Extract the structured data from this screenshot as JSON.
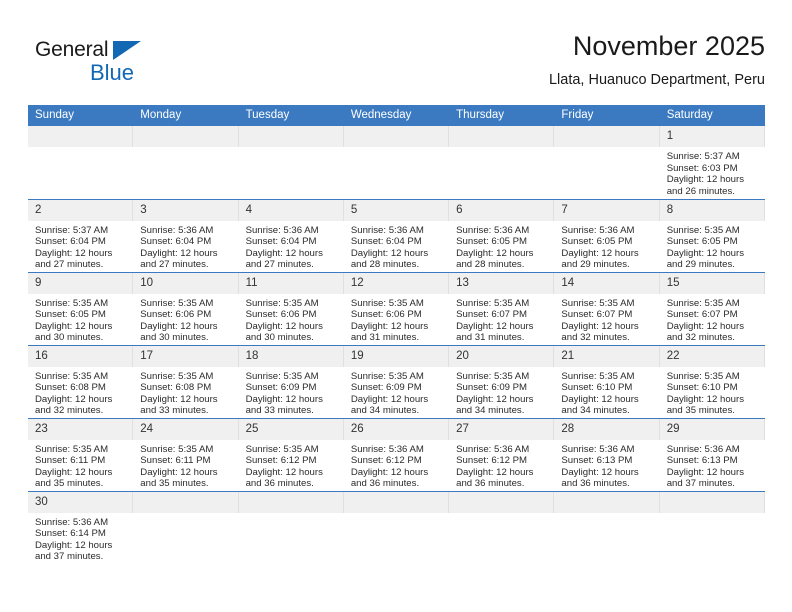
{
  "brand": {
    "name_part1": "General",
    "name_part2": "Blue",
    "triangle_icon": "triangle-icon",
    "accent_color": "#1268b3"
  },
  "header": {
    "title": "November 2025",
    "subtitle": "Llata, Huanuco Department, Peru"
  },
  "calendar": {
    "header_bg": "#3b7ac0",
    "daynum_bg": "#f0f0f0",
    "weekday_headers": [
      "Sunday",
      "Monday",
      "Tuesday",
      "Wednesday",
      "Thursday",
      "Friday",
      "Saturday"
    ],
    "weeks": [
      [
        {
          "day": "",
          "lines": []
        },
        {
          "day": "",
          "lines": []
        },
        {
          "day": "",
          "lines": []
        },
        {
          "day": "",
          "lines": []
        },
        {
          "day": "",
          "lines": []
        },
        {
          "day": "",
          "lines": []
        },
        {
          "day": "1",
          "lines": [
            "Sunrise: 5:37 AM",
            "Sunset: 6:03 PM",
            "Daylight: 12 hours",
            "and 26 minutes."
          ]
        }
      ],
      [
        {
          "day": "2",
          "lines": [
            "Sunrise: 5:37 AM",
            "Sunset: 6:04 PM",
            "Daylight: 12 hours",
            "and 27 minutes."
          ]
        },
        {
          "day": "3",
          "lines": [
            "Sunrise: 5:36 AM",
            "Sunset: 6:04 PM",
            "Daylight: 12 hours",
            "and 27 minutes."
          ]
        },
        {
          "day": "4",
          "lines": [
            "Sunrise: 5:36 AM",
            "Sunset: 6:04 PM",
            "Daylight: 12 hours",
            "and 27 minutes."
          ]
        },
        {
          "day": "5",
          "lines": [
            "Sunrise: 5:36 AM",
            "Sunset: 6:04 PM",
            "Daylight: 12 hours",
            "and 28 minutes."
          ]
        },
        {
          "day": "6",
          "lines": [
            "Sunrise: 5:36 AM",
            "Sunset: 6:05 PM",
            "Daylight: 12 hours",
            "and 28 minutes."
          ]
        },
        {
          "day": "7",
          "lines": [
            "Sunrise: 5:36 AM",
            "Sunset: 6:05 PM",
            "Daylight: 12 hours",
            "and 29 minutes."
          ]
        },
        {
          "day": "8",
          "lines": [
            "Sunrise: 5:35 AM",
            "Sunset: 6:05 PM",
            "Daylight: 12 hours",
            "and 29 minutes."
          ]
        }
      ],
      [
        {
          "day": "9",
          "lines": [
            "Sunrise: 5:35 AM",
            "Sunset: 6:05 PM",
            "Daylight: 12 hours",
            "and 30 minutes."
          ]
        },
        {
          "day": "10",
          "lines": [
            "Sunrise: 5:35 AM",
            "Sunset: 6:06 PM",
            "Daylight: 12 hours",
            "and 30 minutes."
          ]
        },
        {
          "day": "11",
          "lines": [
            "Sunrise: 5:35 AM",
            "Sunset: 6:06 PM",
            "Daylight: 12 hours",
            "and 30 minutes."
          ]
        },
        {
          "day": "12",
          "lines": [
            "Sunrise: 5:35 AM",
            "Sunset: 6:06 PM",
            "Daylight: 12 hours",
            "and 31 minutes."
          ]
        },
        {
          "day": "13",
          "lines": [
            "Sunrise: 5:35 AM",
            "Sunset: 6:07 PM",
            "Daylight: 12 hours",
            "and 31 minutes."
          ]
        },
        {
          "day": "14",
          "lines": [
            "Sunrise: 5:35 AM",
            "Sunset: 6:07 PM",
            "Daylight: 12 hours",
            "and 32 minutes."
          ]
        },
        {
          "day": "15",
          "lines": [
            "Sunrise: 5:35 AM",
            "Sunset: 6:07 PM",
            "Daylight: 12 hours",
            "and 32 minutes."
          ]
        }
      ],
      [
        {
          "day": "16",
          "lines": [
            "Sunrise: 5:35 AM",
            "Sunset: 6:08 PM",
            "Daylight: 12 hours",
            "and 32 minutes."
          ]
        },
        {
          "day": "17",
          "lines": [
            "Sunrise: 5:35 AM",
            "Sunset: 6:08 PM",
            "Daylight: 12 hours",
            "and 33 minutes."
          ]
        },
        {
          "day": "18",
          "lines": [
            "Sunrise: 5:35 AM",
            "Sunset: 6:09 PM",
            "Daylight: 12 hours",
            "and 33 minutes."
          ]
        },
        {
          "day": "19",
          "lines": [
            "Sunrise: 5:35 AM",
            "Sunset: 6:09 PM",
            "Daylight: 12 hours",
            "and 34 minutes."
          ]
        },
        {
          "day": "20",
          "lines": [
            "Sunrise: 5:35 AM",
            "Sunset: 6:09 PM",
            "Daylight: 12 hours",
            "and 34 minutes."
          ]
        },
        {
          "day": "21",
          "lines": [
            "Sunrise: 5:35 AM",
            "Sunset: 6:10 PM",
            "Daylight: 12 hours",
            "and 34 minutes."
          ]
        },
        {
          "day": "22",
          "lines": [
            "Sunrise: 5:35 AM",
            "Sunset: 6:10 PM",
            "Daylight: 12 hours",
            "and 35 minutes."
          ]
        }
      ],
      [
        {
          "day": "23",
          "lines": [
            "Sunrise: 5:35 AM",
            "Sunset: 6:11 PM",
            "Daylight: 12 hours",
            "and 35 minutes."
          ]
        },
        {
          "day": "24",
          "lines": [
            "Sunrise: 5:35 AM",
            "Sunset: 6:11 PM",
            "Daylight: 12 hours",
            "and 35 minutes."
          ]
        },
        {
          "day": "25",
          "lines": [
            "Sunrise: 5:35 AM",
            "Sunset: 6:12 PM",
            "Daylight: 12 hours",
            "and 36 minutes."
          ]
        },
        {
          "day": "26",
          "lines": [
            "Sunrise: 5:36 AM",
            "Sunset: 6:12 PM",
            "Daylight: 12 hours",
            "and 36 minutes."
          ]
        },
        {
          "day": "27",
          "lines": [
            "Sunrise: 5:36 AM",
            "Sunset: 6:12 PM",
            "Daylight: 12 hours",
            "and 36 minutes."
          ]
        },
        {
          "day": "28",
          "lines": [
            "Sunrise: 5:36 AM",
            "Sunset: 6:13 PM",
            "Daylight: 12 hours",
            "and 36 minutes."
          ]
        },
        {
          "day": "29",
          "lines": [
            "Sunrise: 5:36 AM",
            "Sunset: 6:13 PM",
            "Daylight: 12 hours",
            "and 37 minutes."
          ]
        }
      ],
      [
        {
          "day": "30",
          "lines": [
            "Sunrise: 5:36 AM",
            "Sunset: 6:14 PM",
            "Daylight: 12 hours",
            "and 37 minutes."
          ]
        },
        {
          "day": "",
          "lines": []
        },
        {
          "day": "",
          "lines": []
        },
        {
          "day": "",
          "lines": []
        },
        {
          "day": "",
          "lines": []
        },
        {
          "day": "",
          "lines": []
        },
        {
          "day": "",
          "lines": []
        }
      ]
    ]
  }
}
